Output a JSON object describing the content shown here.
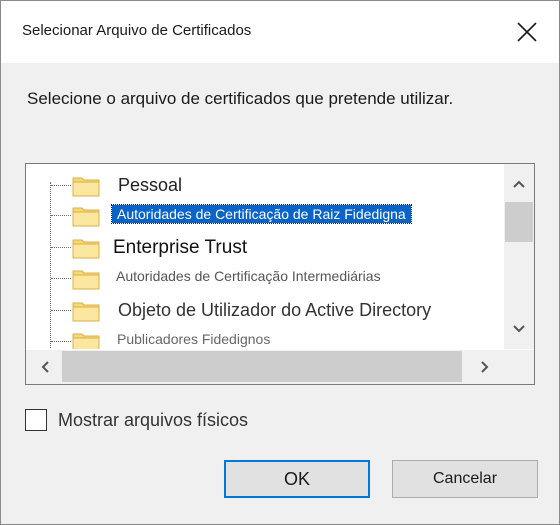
{
  "dialog": {
    "title": "Selecionar Arquivo de Certificados",
    "prompt": "Selecione o arquivo de certificados que pretende utilizar."
  },
  "tree": {
    "items": [
      {
        "label": "Pessoal",
        "selected": false
      },
      {
        "label": "Autoridades de Certificação de Raiz Fidedigna",
        "selected": true
      },
      {
        "label": "Enterprise Trust",
        "selected": false
      },
      {
        "label": "Autoridades de Certificação Intermediárias",
        "selected": false
      },
      {
        "label": "Objeto de Utilizador do Active Directory",
        "selected": false
      },
      {
        "label": "Publicadores Fidedignos",
        "selected": false
      }
    ]
  },
  "options": {
    "show_physical_label": "Mostrar arquivos físicos",
    "show_physical_checked": false
  },
  "buttons": {
    "ok_label": "OK",
    "cancel_label": "Cancelar"
  },
  "colors": {
    "selection": "#0a64c8",
    "ok_border": "#0078d7"
  }
}
